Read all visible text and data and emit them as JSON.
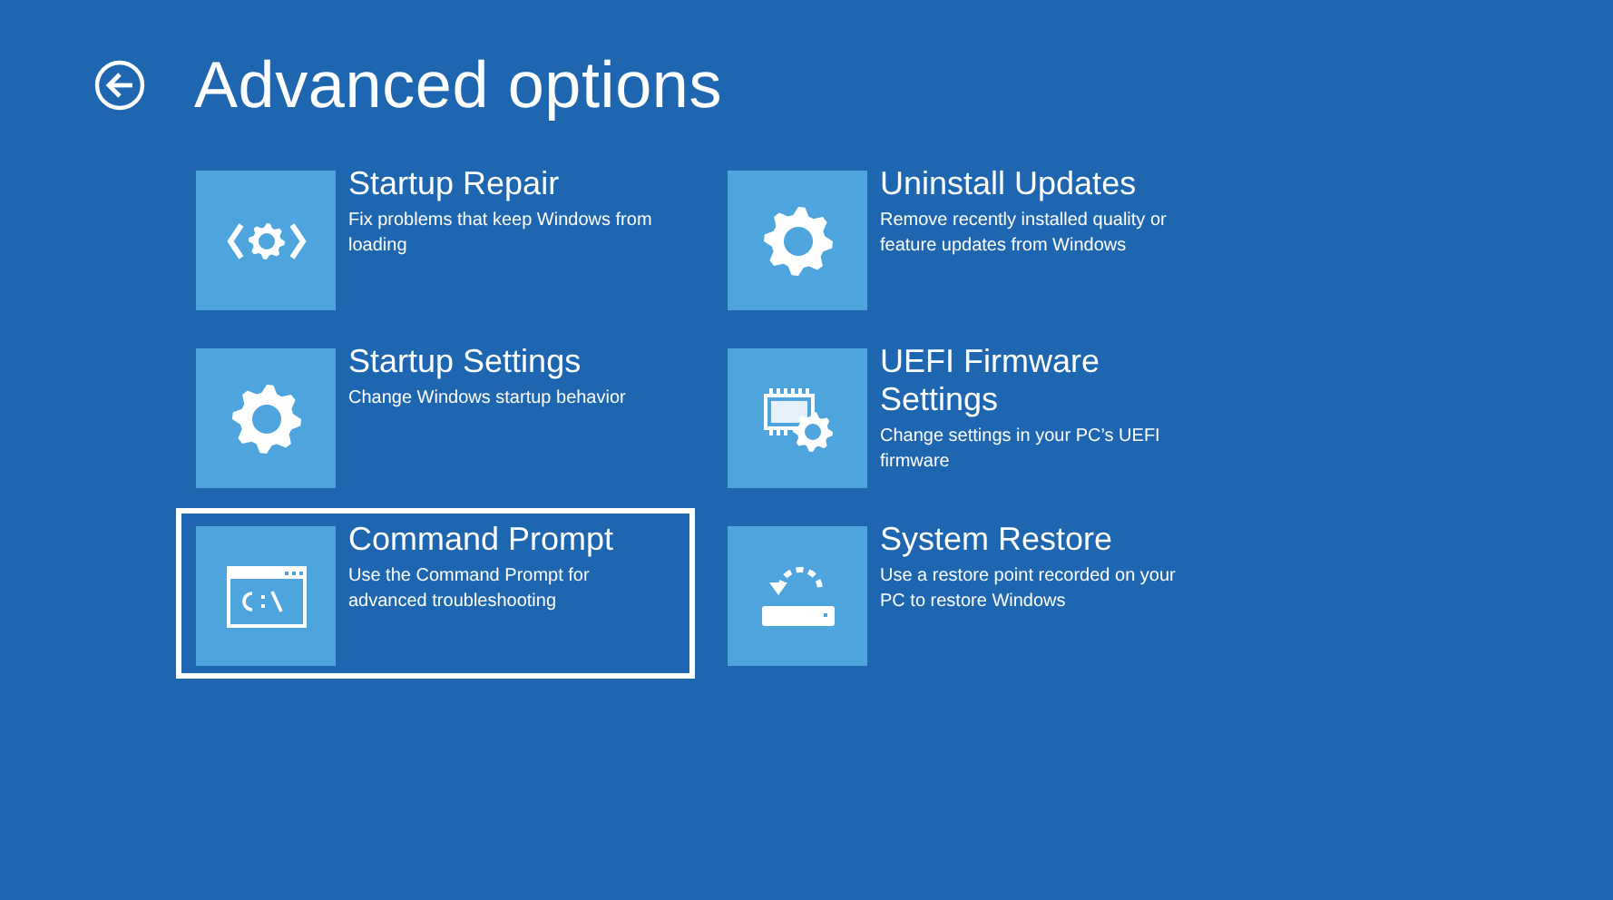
{
  "header": {
    "title": "Advanced options"
  },
  "options": [
    {
      "kind": "repair",
      "title": "Startup Repair",
      "description": "Fix problems that keep Windows from loading",
      "selected": false
    },
    {
      "kind": "gear",
      "title": "Uninstall Updates",
      "description": "Remove recently installed quality or feature updates from Windows",
      "selected": false
    },
    {
      "kind": "gear",
      "title": "Startup Settings",
      "description": "Change Windows startup behavior",
      "selected": false
    },
    {
      "kind": "firmware",
      "title": "UEFI Firmware Settings",
      "description": "Change settings in your PC’s UEFI firmware",
      "selected": false
    },
    {
      "kind": "cmd",
      "title": "Command Prompt",
      "description": "Use the Command Prompt for advanced troubleshooting",
      "selected": true
    },
    {
      "kind": "restore",
      "title": "System Restore",
      "description": "Use a restore point recorded on your PC to restore Windows",
      "selected": false
    }
  ]
}
